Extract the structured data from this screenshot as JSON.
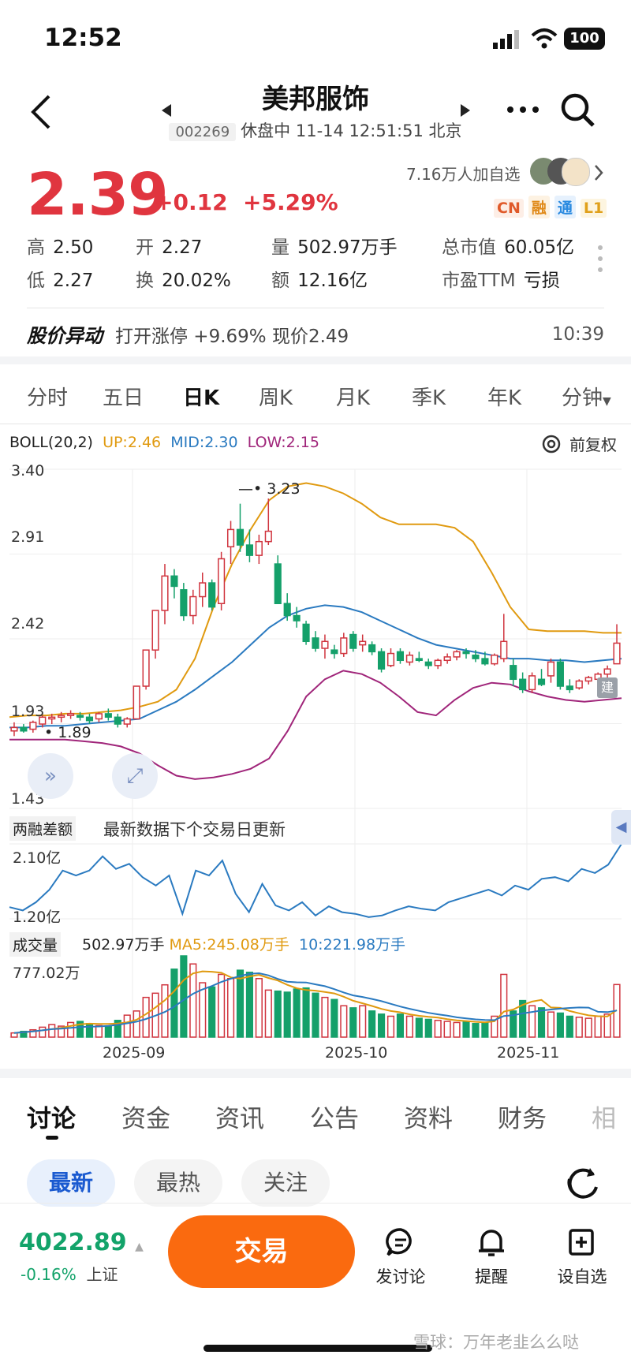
{
  "status_bar": {
    "time": "12:52",
    "battery": "100"
  },
  "header": {
    "title": "美邦服饰",
    "code": "002269",
    "status": "休盘中 11-14 12:51:51 北京"
  },
  "quote": {
    "price": "2.39",
    "change": "+0.12",
    "change_pct": "+5.29%",
    "followers": "7.16万人加自选",
    "tags": [
      "CN",
      "融",
      "通",
      "L1"
    ],
    "stats": [
      {
        "label": "高",
        "value": "2.50"
      },
      {
        "label": "开",
        "value": "2.27"
      },
      {
        "label": "量",
        "value": "502.97万手"
      },
      {
        "label": "总市值",
        "value": "60.05亿"
      },
      {
        "label": "低",
        "value": "2.27"
      },
      {
        "label": "换",
        "value": "20.02%"
      },
      {
        "label": "额",
        "value": "12.16亿"
      },
      {
        "label": "市盈TTM",
        "value": "亏损"
      }
    ]
  },
  "alert": {
    "title": "股价异动",
    "text": "打开涨停 +9.69% 现价2.49",
    "time": "10:39"
  },
  "period_tabs": [
    "分时",
    "五日",
    "日K",
    "周K",
    "月K",
    "季K",
    "年K",
    "分钟"
  ],
  "boll": {
    "name": "BOLL(20,2)",
    "up": "UP:2.46",
    "mid": "MID:2.30",
    "low": "LOW:2.15",
    "adjust": "前复权",
    "y_labels": [
      "3.40",
      "2.91",
      "2.42",
      "1.93",
      "1.43"
    ],
    "high_label": "3.23",
    "low_label": "1.89",
    "badge": "建"
  },
  "margin": {
    "name": "两融差额",
    "note": "最新数据下个交易日更新",
    "y_top": "2.10亿",
    "y_bottom": "1.20亿"
  },
  "volume": {
    "name": "成交量",
    "value": "502.97万手",
    "ma5": "MA5:245.08万手",
    "ma10": "10:221.98万手",
    "y_top": "777.02万",
    "x_labels": [
      "2025-09",
      "2025-10",
      "2025-11"
    ]
  },
  "chart_data": {
    "type": "candlestick",
    "candles": [
      [
        1.88,
        1.93,
        1.85,
        1.9
      ],
      [
        1.9,
        1.92,
        1.87,
        1.88
      ],
      [
        1.89,
        1.94,
        1.87,
        1.93
      ],
      [
        1.92,
        1.97,
        1.9,
        1.96
      ],
      [
        1.95,
        1.98,
        1.92,
        1.96
      ],
      [
        1.96,
        1.99,
        1.93,
        1.97
      ],
      [
        1.97,
        2.0,
        1.95,
        1.98
      ],
      [
        1.97,
        1.99,
        1.94,
        1.96
      ],
      [
        1.96,
        1.98,
        1.92,
        1.94
      ],
      [
        1.95,
        1.99,
        1.93,
        1.98
      ],
      [
        1.98,
        2.01,
        1.94,
        1.96
      ],
      [
        1.96,
        1.98,
        1.9,
        1.92
      ],
      [
        1.92,
        1.96,
        1.9,
        1.95
      ],
      [
        1.95,
        2.14,
        1.95,
        2.14
      ],
      [
        2.14,
        2.35,
        2.12,
        2.35
      ],
      [
        2.35,
        2.58,
        2.3,
        2.58
      ],
      [
        2.58,
        2.85,
        2.5,
        2.78
      ],
      [
        2.78,
        2.82,
        2.65,
        2.72
      ],
      [
        2.7,
        2.74,
        2.52,
        2.55
      ],
      [
        2.55,
        2.7,
        2.5,
        2.66
      ],
      [
        2.66,
        2.8,
        2.6,
        2.74
      ],
      [
        2.74,
        2.76,
        2.58,
        2.6
      ],
      [
        2.62,
        2.92,
        2.58,
        2.88
      ],
      [
        2.95,
        3.1,
        2.85,
        3.05
      ],
      [
        3.05,
        3.2,
        2.92,
        2.96
      ],
      [
        2.96,
        3.05,
        2.86,
        2.9
      ],
      [
        2.9,
        3.02,
        2.85,
        2.98
      ],
      [
        2.98,
        3.23,
        2.96,
        3.04
      ],
      [
        2.85,
        2.9,
        2.62,
        2.62
      ],
      [
        2.62,
        2.68,
        2.52,
        2.55
      ],
      [
        2.55,
        2.6,
        2.48,
        2.52
      ],
      [
        2.5,
        2.52,
        2.38,
        2.4
      ],
      [
        2.42,
        2.46,
        2.34,
        2.36
      ],
      [
        2.36,
        2.44,
        2.3,
        2.4
      ],
      [
        2.35,
        2.38,
        2.3,
        2.33
      ],
      [
        2.33,
        2.45,
        2.31,
        2.42
      ],
      [
        2.44,
        2.46,
        2.34,
        2.36
      ],
      [
        2.38,
        2.44,
        2.34,
        2.4
      ],
      [
        2.38,
        2.4,
        2.32,
        2.34
      ],
      [
        2.34,
        2.36,
        2.22,
        2.24
      ],
      [
        2.26,
        2.36,
        2.25,
        2.33
      ],
      [
        2.34,
        2.36,
        2.27,
        2.29
      ],
      [
        2.28,
        2.34,
        2.26,
        2.32
      ],
      [
        2.3,
        2.34,
        2.28,
        2.29
      ],
      [
        2.28,
        2.3,
        2.24,
        2.26
      ],
      [
        2.26,
        2.3,
        2.24,
        2.29
      ],
      [
        2.29,
        2.33,
        2.27,
        2.31
      ],
      [
        2.31,
        2.35,
        2.29,
        2.34
      ],
      [
        2.34,
        2.36,
        2.3,
        2.33
      ],
      [
        2.32,
        2.35,
        2.28,
        2.3
      ],
      [
        2.3,
        2.34,
        2.26,
        2.27
      ],
      [
        2.27,
        2.33,
        2.26,
        2.32
      ],
      [
        2.3,
        2.56,
        2.28,
        2.4
      ],
      [
        2.26,
        2.3,
        2.14,
        2.18
      ],
      [
        2.18,
        2.22,
        2.1,
        2.12
      ],
      [
        2.12,
        2.22,
        2.1,
        2.2
      ],
      [
        2.18,
        2.24,
        2.14,
        2.15
      ],
      [
        2.2,
        2.3,
        2.16,
        2.28
      ],
      [
        2.28,
        2.3,
        2.12,
        2.14
      ],
      [
        2.14,
        2.18,
        2.1,
        2.12
      ],
      [
        2.13,
        2.18,
        2.12,
        2.17
      ],
      [
        2.17,
        2.2,
        2.15,
        2.19
      ],
      [
        2.18,
        2.22,
        2.16,
        2.21
      ],
      [
        2.21,
        2.26,
        2.19,
        2.24
      ],
      [
        2.27,
        2.5,
        2.27,
        2.39
      ]
    ],
    "boll_up": [
      1.96,
      1.97,
      1.97,
      1.98,
      1.98,
      1.99,
      2.0,
      2.02,
      2.05,
      2.12,
      2.3,
      2.6,
      2.85,
      3.05,
      3.22,
      3.3,
      3.32,
      3.3,
      3.26,
      3.2,
      3.12,
      3.08,
      3.08,
      3.08,
      3.06,
      2.98,
      2.8,
      2.6,
      2.47,
      2.46,
      2.46,
      2.46,
      2.45,
      2.45
    ],
    "boll_mid": [
      1.9,
      1.9,
      1.91,
      1.91,
      1.92,
      1.93,
      1.94,
      1.95,
      2.0,
      2.05,
      2.12,
      2.2,
      2.28,
      2.38,
      2.48,
      2.55,
      2.59,
      2.61,
      2.6,
      2.57,
      2.52,
      2.47,
      2.42,
      2.38,
      2.36,
      2.34,
      2.32,
      2.3,
      2.3,
      2.29,
      2.29,
      2.28,
      2.29,
      2.3
    ],
    "boll_low": [
      1.83,
      1.83,
      1.83,
      1.83,
      1.82,
      1.81,
      1.79,
      1.75,
      1.68,
      1.62,
      1.6,
      1.61,
      1.63,
      1.66,
      1.72,
      1.88,
      2.08,
      2.18,
      2.23,
      2.21,
      2.16,
      2.08,
      1.99,
      1.97,
      2.06,
      2.13,
      2.16,
      2.15,
      2.11,
      2.08,
      2.06,
      2.05,
      2.06,
      2.07
    ],
    "margin_balance": [
      1.34,
      1.3,
      1.4,
      1.55,
      1.78,
      1.72,
      1.78,
      1.95,
      1.8,
      1.86,
      1.7,
      1.6,
      1.72,
      1.26,
      1.78,
      1.72,
      1.9,
      1.5,
      1.28,
      1.62,
      1.36,
      1.3,
      1.4,
      1.24,
      1.35,
      1.28,
      1.26,
      1.22,
      1.24,
      1.3,
      1.35,
      1.32,
      1.3,
      1.4,
      1.45,
      1.5,
      1.55,
      1.48,
      1.6,
      1.55,
      1.68,
      1.7,
      1.65,
      1.8,
      1.75,
      1.85,
      2.1
    ],
    "volume": [
      40,
      55,
      70,
      95,
      120,
      105,
      140,
      150,
      130,
      110,
      100,
      160,
      210,
      250,
      380,
      420,
      500,
      650,
      777,
      700,
      520,
      480,
      600,
      560,
      640,
      620,
      560,
      450,
      440,
      430,
      460,
      470,
      420,
      380,
      360,
      300,
      280,
      300,
      250,
      220,
      200,
      220,
      200,
      180,
      170,
      160,
      150,
      140,
      150,
      130,
      140,
      200,
      600,
      250,
      350,
      300,
      280,
      240,
      230,
      200,
      190,
      180,
      200,
      220,
      503
    ],
    "volume_up": [
      true,
      false,
      true,
      true,
      true,
      true,
      true,
      false,
      false,
      true,
      false,
      false,
      true,
      true,
      true,
      true,
      true,
      false,
      false,
      true,
      true,
      false,
      true,
      true,
      false,
      false,
      true,
      true,
      false,
      false,
      false,
      false,
      false,
      true,
      false,
      true,
      false,
      true,
      false,
      false,
      true,
      false,
      true,
      false,
      false,
      true,
      true,
      true,
      false,
      false,
      false,
      true,
      true,
      false,
      false,
      true,
      false,
      true,
      false,
      false,
      true,
      true,
      true,
      true,
      true
    ],
    "ylim_price": [
      1.43,
      3.4
    ],
    "ylim_margin": [
      1.2,
      2.1
    ],
    "ylim_volume": [
      0,
      777.02
    ],
    "x_ticks": [
      "2025-09",
      "2025-10",
      "2025-11"
    ]
  },
  "bottom_tabs": [
    "讨论",
    "资金",
    "资讯",
    "公告",
    "资料",
    "财务",
    "相"
  ],
  "sub_tabs": [
    "最新",
    "最热",
    "关注"
  ],
  "footer": {
    "index_value": "4022.89",
    "index_change": "-0.16%",
    "index_name": "上证",
    "trade": "交易",
    "actions": [
      "发讨论",
      "提醒",
      "设自选"
    ],
    "watermark": "雪球：万年老韭么么哒"
  }
}
